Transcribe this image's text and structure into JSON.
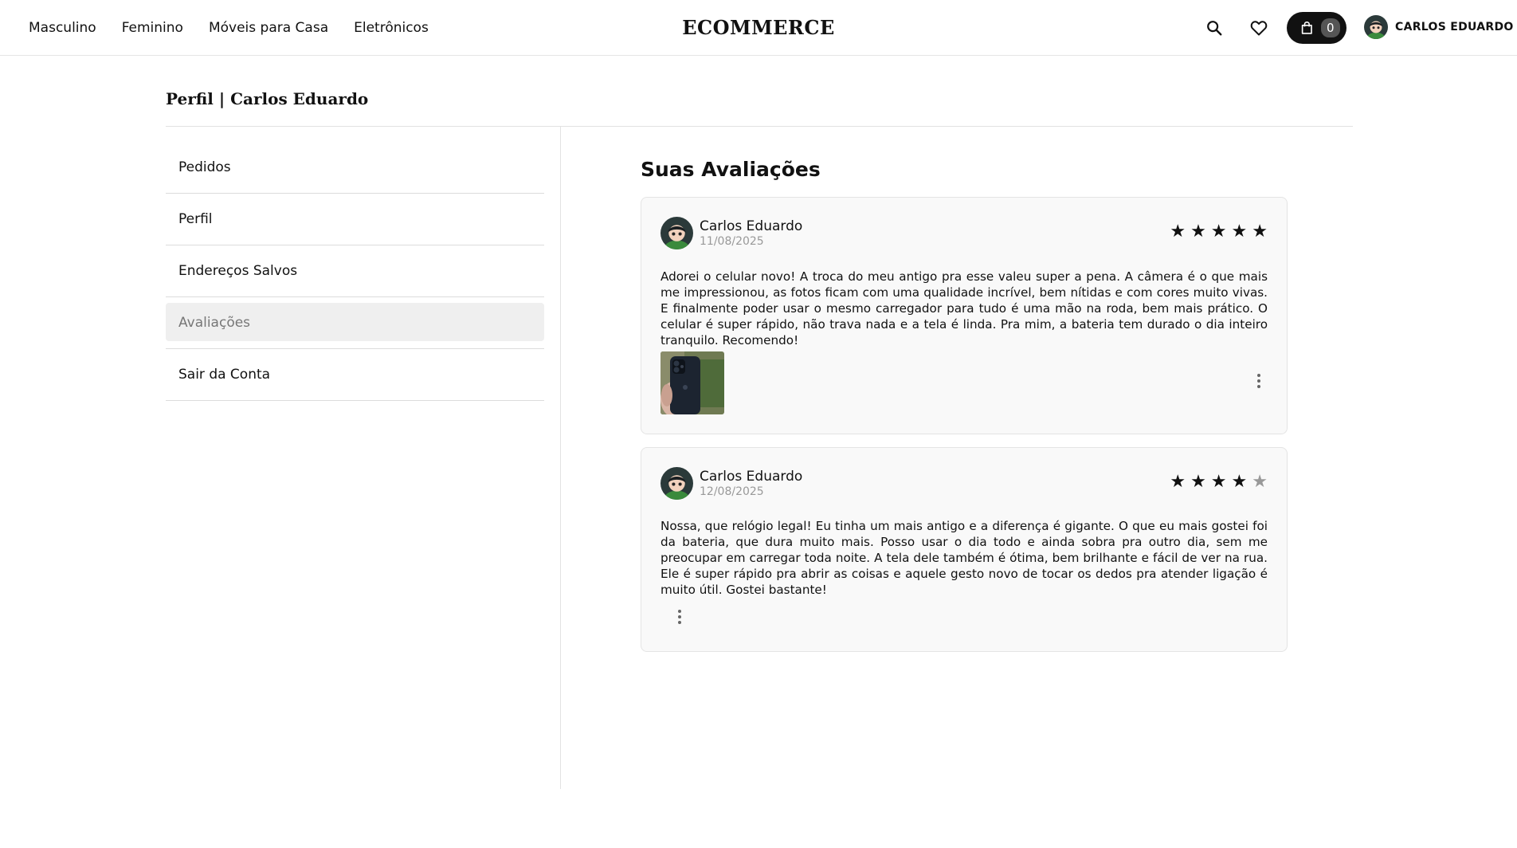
{
  "header": {
    "nav": [
      "Masculino",
      "Feminino",
      "Móveis para Casa",
      "Eletrônicos"
    ],
    "logo": "ECOMMERCE",
    "cart_count": "0",
    "user_name": "CARLOS EDUARDO"
  },
  "page": {
    "title": "Perfil | Carlos Eduardo"
  },
  "sidebar": {
    "items": [
      "Pedidos",
      "Perfil",
      "Endereços Salvos",
      "Avaliações",
      "Sair da Conta"
    ],
    "active_item": "Avaliações"
  },
  "reviews_section": {
    "title": "Suas Avaliações",
    "reviews": [
      {
        "author": "Carlos Eduardo",
        "date": "11/08/2025",
        "rating": 5,
        "max_rating": 5,
        "text": "Adorei o celular novo! A troca do meu antigo pra esse valeu super a pena. A câmera é o que mais me impressionou, as fotos ficam com uma qualidade incrível, bem nítidas e com cores muito vivas. E finalmente poder usar o mesmo carregador para tudo é uma mão na roda, bem mais prático. O celular é super rápido, não trava nada e a tela é linda. Pra mim, a bateria tem durado o dia inteiro tranquilo. Recomendo!",
        "has_photo": true
      },
      {
        "author": "Carlos Eduardo",
        "date": "12/08/2025",
        "rating": 4,
        "max_rating": 5,
        "text": "Nossa, que relógio legal! Eu tinha um mais antigo e a diferença é gigante. O que eu mais gostei foi da bateria, que dura muito mais. Posso usar o dia todo e ainda sobra pra outro dia, sem me preocupar em carregar toda noite. A tela dele também é ótima, bem brilhante e fácil de ver na rua. Ele é super rápido pra abrir as coisas e aquele gesto novo de tocar os dedos pra atender ligação é muito útil. Gostei bastante!",
        "has_photo": false
      }
    ]
  },
  "colors": {
    "accent": "#111111",
    "active_bg": "#efefef",
    "card_bg": "#f9f9f9",
    "muted_text": "#999999",
    "star_empty": "#999999"
  },
  "icons": [
    "search-icon",
    "heart-icon",
    "shopping-bag-icon",
    "more-vertical-icon"
  ]
}
